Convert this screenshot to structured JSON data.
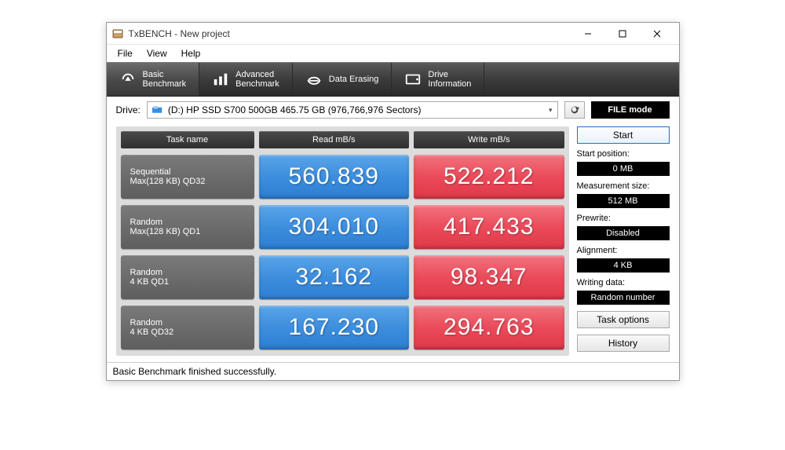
{
  "window": {
    "title": "TxBENCH - New project"
  },
  "menu": {
    "file": "File",
    "view": "View",
    "help": "Help"
  },
  "tabs": {
    "basic": "Basic\nBenchmark",
    "advanced": "Advanced\nBenchmark",
    "erase": "Data Erasing",
    "drive": "Drive\nInformation"
  },
  "drive": {
    "label": "Drive:",
    "selected": "(D:) HP SSD S700 500GB  465.75 GB (976,766,976 Sectors)",
    "mode_btn": "FILE mode"
  },
  "headers": {
    "task": "Task name",
    "read": "Read mB/s",
    "write": "Write mB/s"
  },
  "rows": [
    {
      "t1": "Sequential",
      "t2": "Max(128 KB) QD32",
      "read": "560.839",
      "write": "522.212"
    },
    {
      "t1": "Random",
      "t2": "Max(128 KB) QD1",
      "read": "304.010",
      "write": "417.433"
    },
    {
      "t1": "Random",
      "t2": "4 KB QD1",
      "read": "32.162",
      "write": "98.347"
    },
    {
      "t1": "Random",
      "t2": "4 KB QD32",
      "read": "167.230",
      "write": "294.763"
    }
  ],
  "side": {
    "start": "Start",
    "startpos_label": "Start position:",
    "startpos_value": "0 MB",
    "measure_label": "Measurement size:",
    "measure_value": "512 MB",
    "prewrite_label": "Prewrite:",
    "prewrite_value": "Disabled",
    "align_label": "Alignment:",
    "align_value": "4 KB",
    "writedata_label": "Writing data:",
    "writedata_value": "Random number",
    "taskopts": "Task options",
    "history": "History"
  },
  "status": "Basic Benchmark finished successfully.",
  "chart_data": {
    "type": "table",
    "title": "TxBENCH Basic Benchmark Results",
    "columns": [
      "Task name",
      "Read mB/s",
      "Write mB/s"
    ],
    "rows": [
      [
        "Sequential Max(128 KB) QD32",
        560.839,
        522.212
      ],
      [
        "Random Max(128 KB) QD1",
        304.01,
        417.433
      ],
      [
        "Random 4 KB QD1",
        32.162,
        98.347
      ],
      [
        "Random 4 KB QD32",
        167.23,
        294.763
      ]
    ]
  }
}
